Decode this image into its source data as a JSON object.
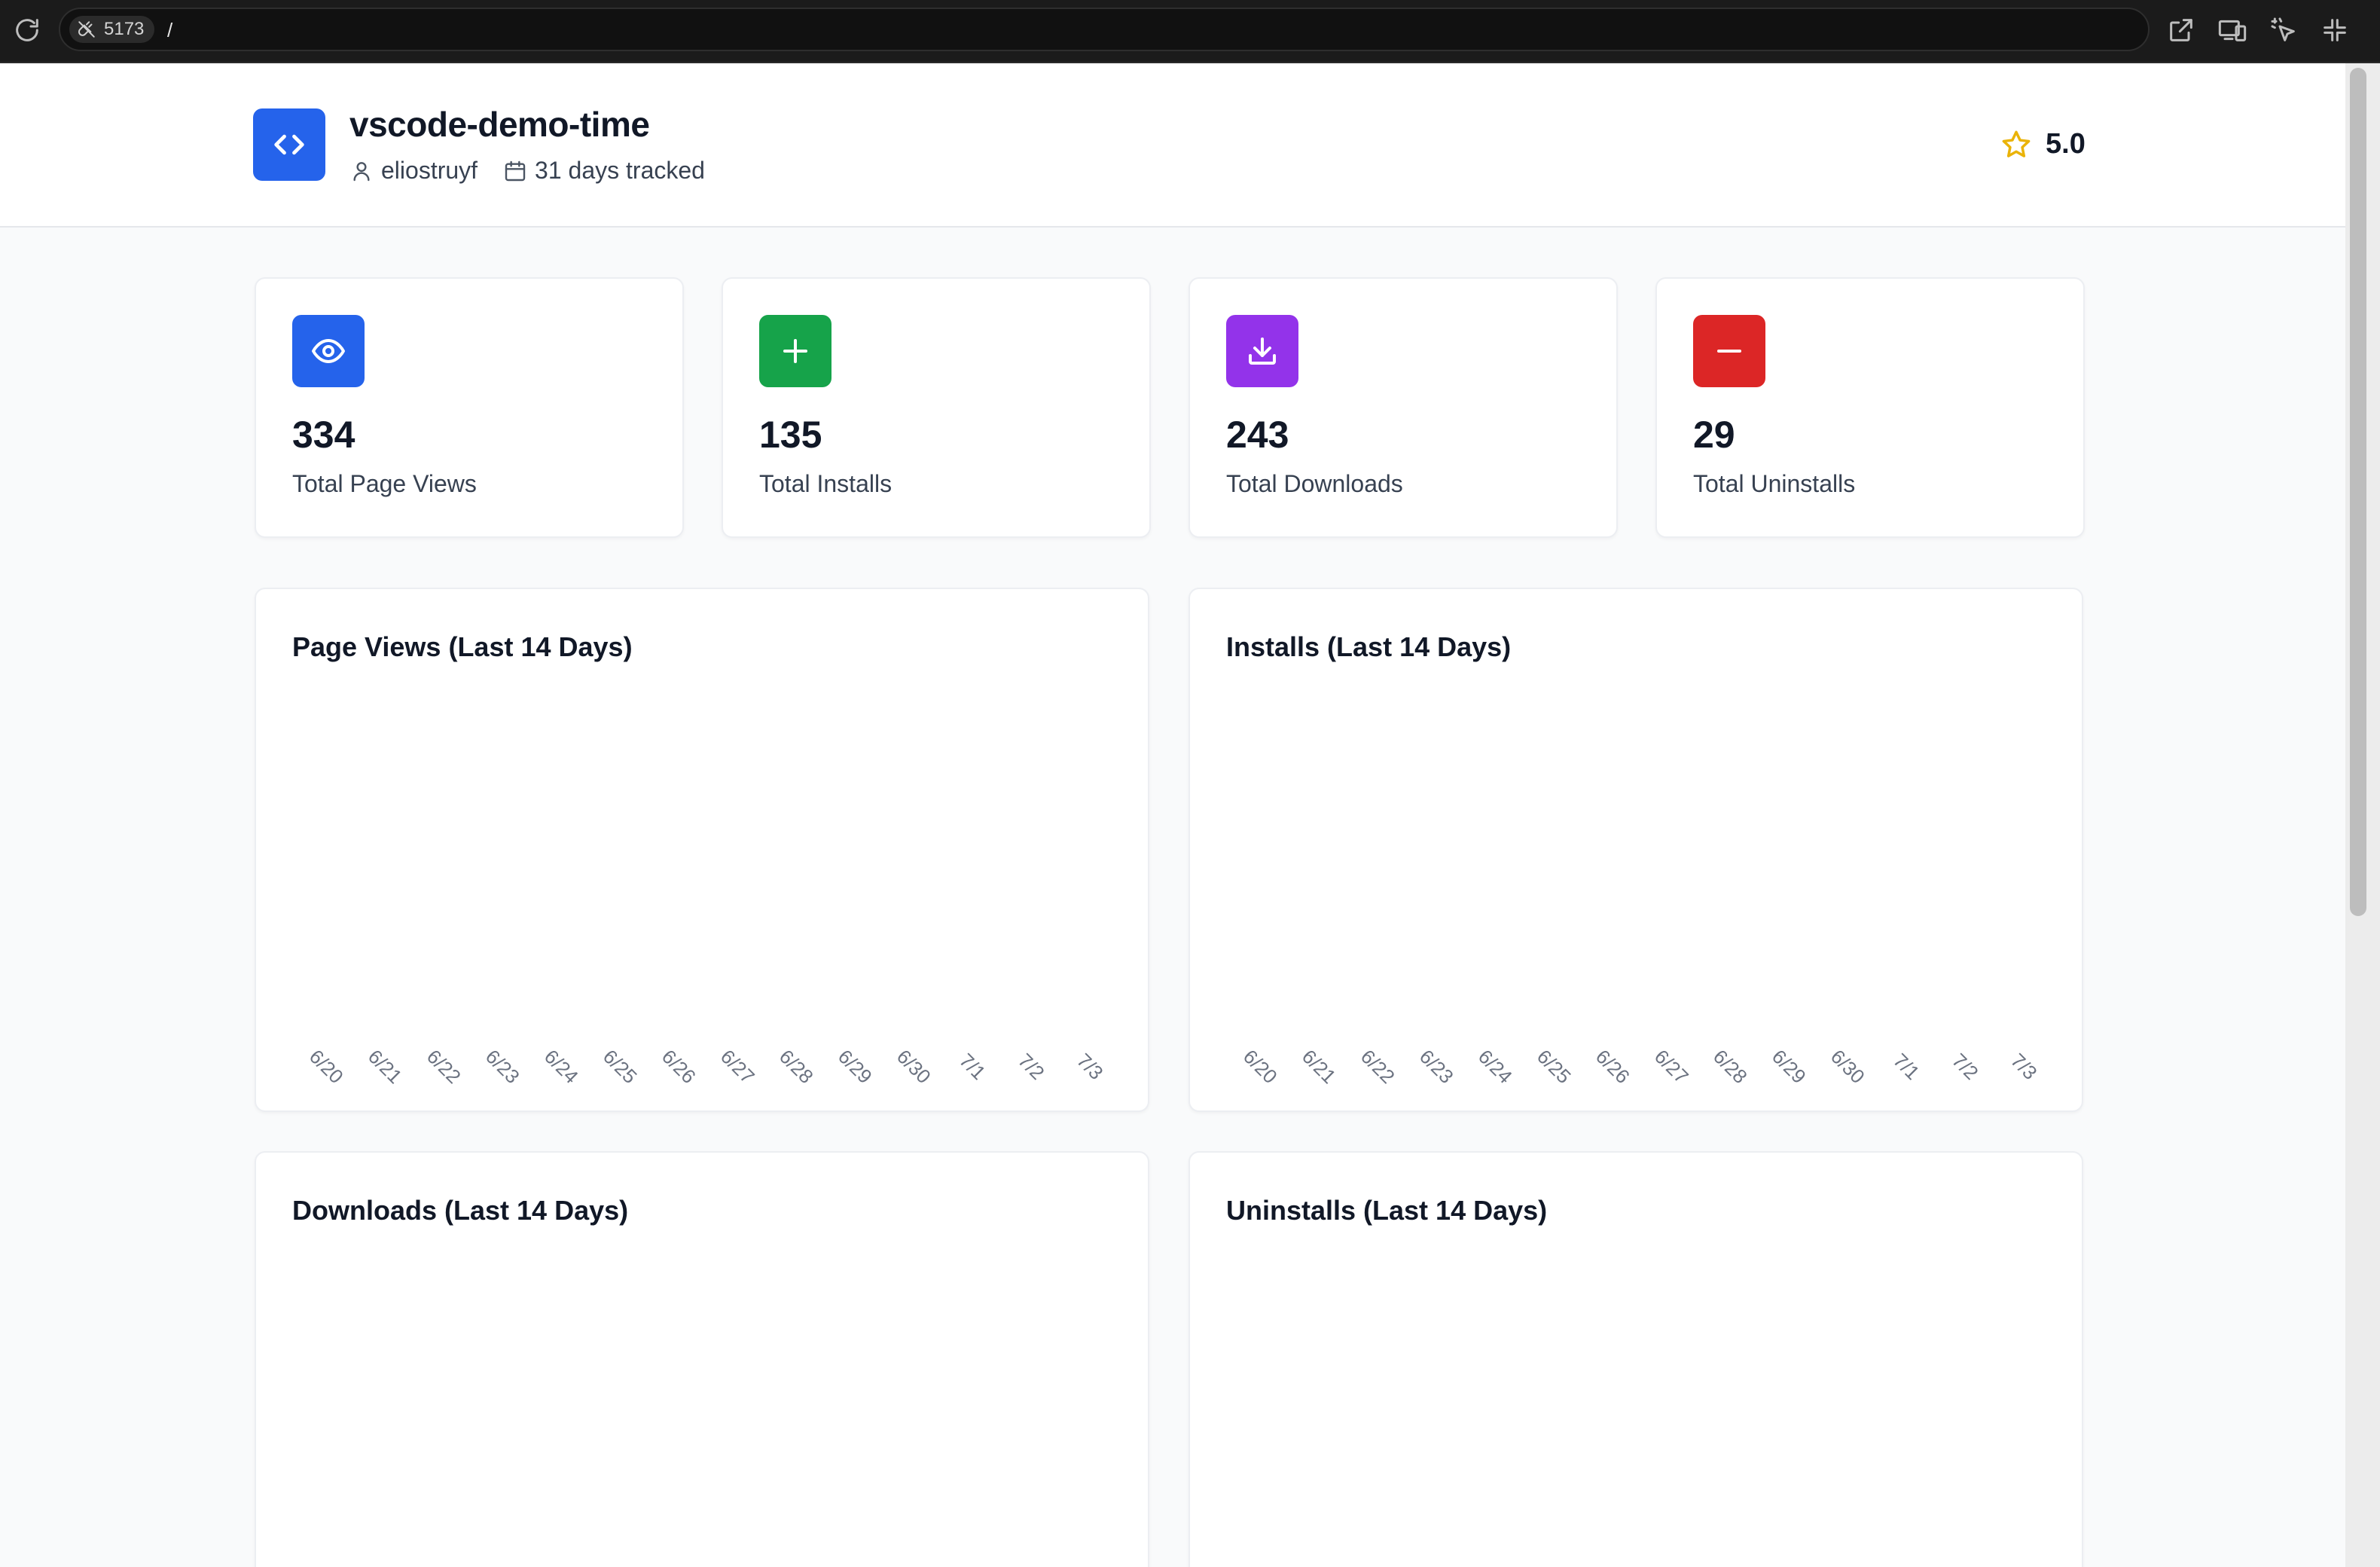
{
  "browser": {
    "port": "5173",
    "path": "/"
  },
  "header": {
    "title": "vscode-demo-time",
    "author": "eliostruyf",
    "tracked": "31 days tracked",
    "rating": "5.0"
  },
  "colors": {
    "blue": "#2563eb",
    "green": "#16a34a",
    "purple": "#9333ea",
    "red": "#dc2626",
    "star": "#eab308"
  },
  "stats": [
    {
      "value": "334",
      "label": "Total Page Views",
      "icon": "eye-icon"
    },
    {
      "value": "135",
      "label": "Total Installs",
      "icon": "plus-icon"
    },
    {
      "value": "243",
      "label": "Total Downloads",
      "icon": "download-icon"
    },
    {
      "value": "29",
      "label": "Total Uninstalls",
      "icon": "minus-icon"
    }
  ],
  "chart_data": [
    {
      "type": "bar",
      "title": "Page Views (Last 14 Days)",
      "categories": [
        "6/20",
        "6/21",
        "6/22",
        "6/23",
        "6/24",
        "6/25",
        "6/26",
        "6/27",
        "6/28",
        "6/29",
        "6/30",
        "7/1",
        "7/2",
        "7/3"
      ]
    },
    {
      "type": "bar",
      "title": "Installs (Last 14 Days)",
      "categories": [
        "6/20",
        "6/21",
        "6/22",
        "6/23",
        "6/24",
        "6/25",
        "6/26",
        "6/27",
        "6/28",
        "6/29",
        "6/30",
        "7/1",
        "7/2",
        "7/3"
      ]
    },
    {
      "type": "bar",
      "title": "Downloads (Last 14 Days)"
    },
    {
      "type": "bar",
      "title": "Uninstalls (Last 14 Days)"
    }
  ]
}
